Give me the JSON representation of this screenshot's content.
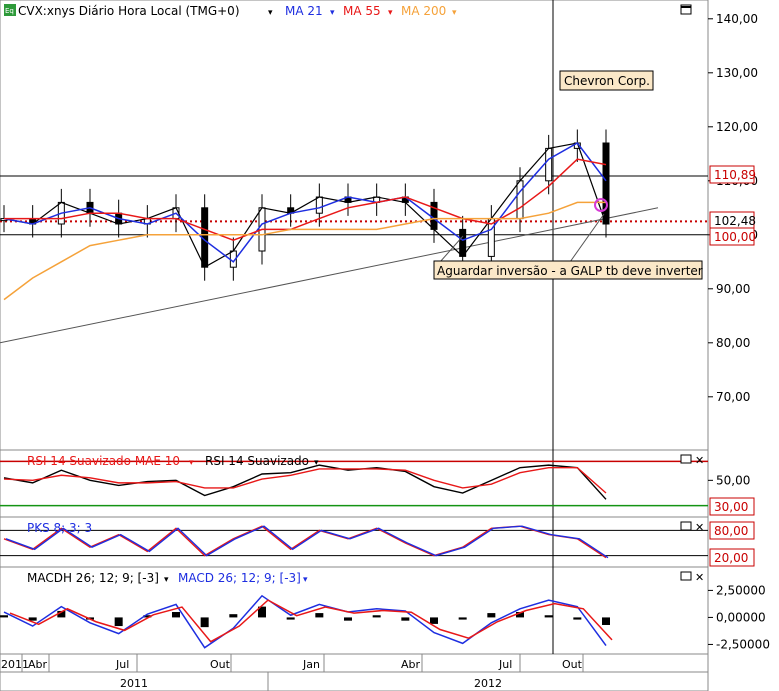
{
  "main": {
    "header": {
      "icon": "Eq",
      "title": "CVX:xnys Diário Hora Local (TMG+0)",
      "ma21": "MA 21",
      "ma55": "MA 55",
      "ma200": "MA 200"
    },
    "company_label": "Chevron Corp.",
    "annotation": "Aguardar inversão - a GALP tb deve inverter",
    "price_tags": {
      "h1": "110,89",
      "last": "102,48",
      "h2": "100,00"
    }
  },
  "rsi": {
    "title": "RSI 14 Suavizado MAE 10",
    "title2": "RSI 14 Suavizado",
    "tag": "30,00"
  },
  "pks": {
    "title": "PKS 8; 3; 3",
    "tag_hi": "80,00",
    "tag_lo": "20,00"
  },
  "macd": {
    "title1": "MACDH 26; 12; 9; [-3]",
    "title2": "MACD 26; 12; 9; [-3]"
  },
  "axis": {
    "time_months": [
      "2011",
      "Abr",
      "Jul",
      "Out",
      "Jan",
      "Abr",
      "Jul",
      "Out"
    ],
    "years": [
      "2011",
      "2012"
    ]
  },
  "colors": {
    "price": "#000000",
    "ma21": "#1e2ee0",
    "ma55": "#e81818",
    "ma200": "#f5a23a",
    "level": "#c80000",
    "green": "#149414"
  },
  "chart_data": [
    {
      "type": "candlestick",
      "title": "CVX:xnys Diário Hora Local (TMG+0)",
      "series": [
        {
          "name": "CVX",
          "x": [
            "2011-01",
            "2011-02",
            "2011-03",
            "2011-04",
            "2011-05",
            "2011-06",
            "2011-07",
            "2011-08",
            "2011-09",
            "2011-10",
            "2011-11",
            "2011-12",
            "2012-01",
            "2012-02",
            "2012-03",
            "2012-04",
            "2012-05",
            "2012-06",
            "2012-07",
            "2012-08",
            "2012-09",
            "2012-10"
          ],
          "values": [
            103,
            102,
            106,
            104,
            102,
            103,
            105,
            94,
            97,
            105,
            104,
            107,
            106,
            107,
            106,
            101,
            96,
            103,
            110,
            116,
            117,
            102
          ]
        },
        {
          "name": "MA 21",
          "values": [
            103,
            102,
            104,
            105,
            103,
            102,
            104,
            99,
            95,
            102,
            104,
            105,
            107,
            106,
            107,
            103,
            99,
            101,
            108,
            114,
            117,
            110
          ]
        },
        {
          "name": "MA 55",
          "values": [
            103,
            103,
            103,
            104,
            104,
            103,
            103,
            101,
            99,
            101,
            101,
            103,
            105,
            106,
            107,
            105,
            103,
            102,
            105,
            109,
            114,
            113
          ]
        },
        {
          "name": "MA 200",
          "values": [
            88,
            92,
            95,
            98,
            99,
            100,
            100,
            100,
            100,
            100,
            101,
            101,
            101,
            101,
            102,
            103,
            103,
            103,
            103,
            104,
            106,
            106
          ]
        }
      ],
      "ylim": [
        62,
        142
      ],
      "y_ticks": [
        "140,00",
        "130,00",
        "120,00",
        "110,00",
        "100,00",
        "90,00",
        "80,00",
        "70,00"
      ],
      "y_tick_values": [
        140,
        130,
        120,
        110,
        100,
        90,
        80,
        70
      ],
      "hlines": [
        110.89,
        102.48,
        100.0
      ],
      "trendline": {
        "x": [
          "2011-01",
          "2012-11"
        ],
        "y": [
          80,
          105
        ]
      }
    },
    {
      "type": "line",
      "title": "RSI 14 Suavizado MAE 10",
      "series": [
        {
          "name": "RSI 14 Suavizado",
          "values": [
            52,
            48,
            58,
            50,
            46,
            49,
            50,
            38,
            45,
            55,
            56,
            62,
            58,
            60,
            57,
            45,
            40,
            50,
            60,
            62,
            60,
            35
          ]
        },
        {
          "name": "MAE 10",
          "values": [
            51,
            50,
            54,
            52,
            48,
            48,
            49,
            44,
            44,
            51,
            54,
            59,
            59,
            59,
            58,
            50,
            44,
            47,
            56,
            60,
            60,
            40
          ]
        }
      ],
      "ylim": [
        25,
        70
      ],
      "y_ticks": [
        "50,00"
      ],
      "y_tick_values": [
        50
      ],
      "hlines": [
        65,
        30
      ]
    },
    {
      "type": "line",
      "title": "PKS 8; 3; 3",
      "series": [
        {
          "name": "PKS 8; 3; 3",
          "values": [
            60,
            35,
            85,
            40,
            70,
            30,
            85,
            20,
            60,
            90,
            35,
            80,
            60,
            85,
            50,
            20,
            40,
            85,
            90,
            70,
            60,
            15
          ]
        }
      ],
      "ylim": [
        0,
        100
      ],
      "hlines": [
        80,
        20
      ]
    },
    {
      "type": "bar",
      "title": "MACDH 26; 12; 9; [-3]",
      "series": [
        {
          "name": "MACDH 26; 12; 9; [-3]",
          "values": [
            0.2,
            -0.3,
            0.6,
            -0.2,
            -0.8,
            0.2,
            0.5,
            -0.9,
            0.3,
            1.0,
            -0.2,
            0.4,
            -0.3,
            0.2,
            -0.3,
            -0.6,
            -0.2,
            0.4,
            0.5,
            0.2,
            -0.2,
            -0.7
          ]
        },
        {
          "name": "MACD 26; 12; 9; [-3]",
          "values": [
            0.5,
            -0.8,
            1.0,
            -0.5,
            -1.5,
            0.3,
            1.2,
            -2.8,
            -1.0,
            2.0,
            0.2,
            1.2,
            0.5,
            0.8,
            0.6,
            -1.4,
            -2.4,
            -0.5,
            0.8,
            1.6,
            1.0,
            -2.6
          ]
        }
      ],
      "ylim": [
        -3.2,
        3.0
      ],
      "y_ticks": [
        "2,50000",
        "0,00000",
        "-2,50000"
      ],
      "y_tick_values": [
        2.5,
        0,
        -2.5
      ]
    }
  ]
}
